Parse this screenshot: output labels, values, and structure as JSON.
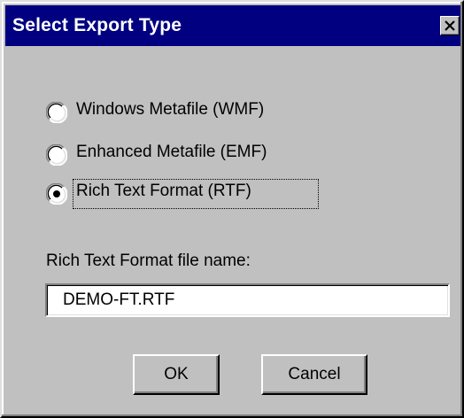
{
  "window": {
    "title": "Select Export Type",
    "close_icon": "close-icon"
  },
  "export_options": [
    {
      "label": "Windows Metafile (WMF)",
      "selected": false
    },
    {
      "label": "Enhanced Metafile (EMF)",
      "selected": false
    },
    {
      "label": "Rich Text Format (RTF)",
      "selected": true
    }
  ],
  "filename": {
    "label": "Rich Text Format file name:",
    "value": "DEMO-FT.RTF"
  },
  "buttons": {
    "ok": "OK",
    "cancel": "Cancel"
  },
  "colors": {
    "title_bar": "#000080",
    "dialog_face": "#c0c0c0",
    "input_bg": "#ffffff"
  }
}
